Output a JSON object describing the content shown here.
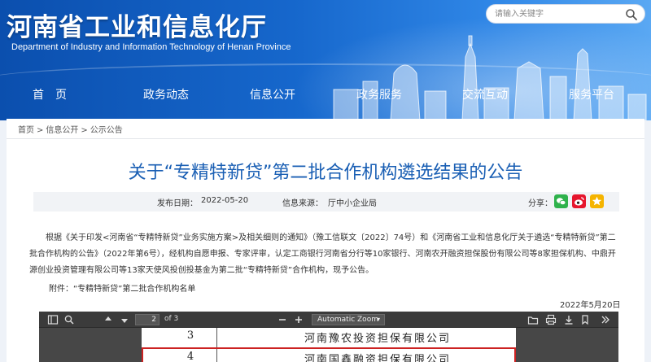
{
  "header": {
    "title": "河南省工业和信息化厅",
    "subtitle": "Department of Industry and Information Technology of Henan Province",
    "search_placeholder": "请输入关键字",
    "nav": [
      "首　页",
      "政务动态",
      "信息公开",
      "政务服务",
      "交流互动",
      "服务平台"
    ]
  },
  "breadcrumb": {
    "items": [
      "首页",
      "信息公开",
      "公示公告"
    ],
    "separator": ">"
  },
  "article": {
    "title": "关于“专精特新贷”第二批合作机构遴选结果的公告",
    "publish_label": "发布日期：",
    "publish_date": "2022-05-20",
    "source_label": "信息来源：",
    "source": "厅中小企业局",
    "share_label": "分享：",
    "body": "根据《关于印发<河南省“专精特新贷”业务实施方案>及相关细则的通知》（豫工信联文〔2022〕74号）和《河南省工业和信息化厅关于遴选“专精特新贷”第二批合作机构的公告》（2022年第6号），经机构自愿申报、专家评审，认定工商银行河南省分行等10家银行、河南农开融资担保股份有限公司等8家担保机构、中鼎开源创业投资管理有限公司等13家天使风投创投基金为第二批“专精特新贷”合作机构，现予公告。",
    "attachment": "附件：“专精特新贷”第二批合作机构名单",
    "date": "2022年5月20日"
  },
  "pdf_viewer": {
    "current_page": "2",
    "page_total": "of 3",
    "zoom": "Automatic Zoom",
    "rows": [
      {
        "num": "3",
        "name": "河南豫农投资担保有限公司"
      },
      {
        "num": "4",
        "name": "河南国鑫融资担保有限公司"
      }
    ]
  },
  "colors": {
    "header_blue": "#1667cc",
    "title_blue": "#1a5fb4",
    "wechat_green": "#2fb24c",
    "weibo_red": "#e6162d",
    "favorite_yellow": "#f5b400"
  }
}
